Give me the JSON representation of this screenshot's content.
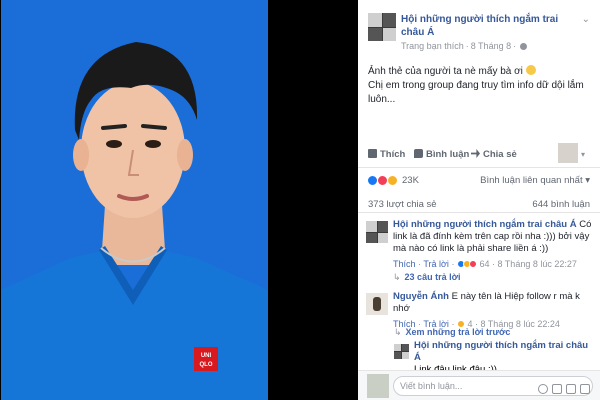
{
  "post": {
    "group_name": "Hội những người thích ngắm trai châu Á",
    "meta_source": "Trang bạn thích",
    "meta_date": "8 Tháng 8",
    "text_line1": "Ảnh thẻ của người ta nè mấy bà ơi",
    "text_line2": "Chị em trong group đang truy tìm info dữ dội lắm luôn..."
  },
  "actions": {
    "like": "Thích",
    "comment": "Bình luận",
    "share": "Chia sẻ"
  },
  "stats": {
    "reactions_count": "23K",
    "comment_sort": "Bình luận liên quan nhất ▾",
    "shares": "373 lượt chia sẻ",
    "comments": "644 bình luận"
  },
  "comments": [
    {
      "author": "Hội những người thích ngắm trai châu Á",
      "text": "Có link là đã đính kèm trên cap rồi nha :))) bởi vậy mà nào có link là phải share liền á :))",
      "like_label": "Thích",
      "reply_label": "Trả lời",
      "reaction_count": "64",
      "date": "8 Tháng 8 lúc 22:27",
      "replies_link": "23 câu trả lời"
    },
    {
      "author": "Nguyễn Ánh",
      "text": "E này tên là Hiệp follow r mà k nhớ",
      "like_label": "Thích",
      "reply_label": "Trả lời",
      "reaction_count": "4",
      "date": "8 Tháng 8 lúc 22:24",
      "replies_link": "Xem những trả lời trước"
    }
  ],
  "reply": {
    "author": "Hội những người thích ngắm trai châu Á",
    "text": "Link đâu link đâu :))"
  },
  "comment_box": {
    "placeholder": "Viết bình luận..."
  },
  "colors": {
    "photo_background": "#1b6ed8",
    "link_blue": "#365899",
    "like_blue": "#1877f2",
    "love_red": "#f33e58",
    "haha_yellow": "#f7b125"
  }
}
